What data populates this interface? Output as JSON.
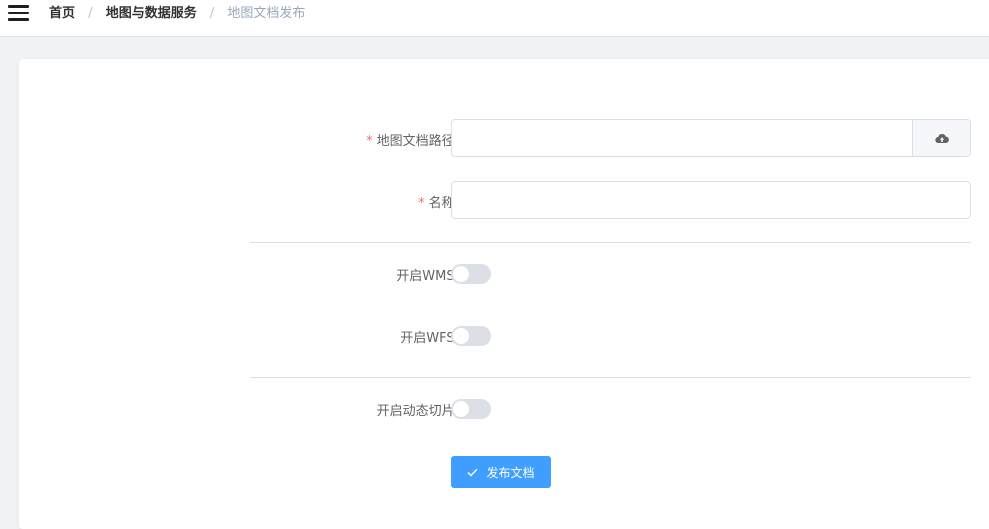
{
  "header": {
    "breadcrumb": {
      "home": "首页",
      "section": "地图与数据服务",
      "current": "地图文档发布",
      "separator": "/"
    }
  },
  "form": {
    "path_field": {
      "required_mark": "*",
      "label": "地图文档路径:",
      "value": "",
      "placeholder": "",
      "upload_icon": "cloud-upload-icon"
    },
    "name_field": {
      "required_mark": "*",
      "label": "名称:",
      "value": "",
      "placeholder": ""
    },
    "wms_switch": {
      "label": "开启WMS:",
      "enabled": false
    },
    "wfs_switch": {
      "label": "开启WFS:",
      "enabled": false
    },
    "tile_switch": {
      "label": "开启动态切片:",
      "enabled": false
    },
    "submit": {
      "label": "发布文档",
      "icon": "check-icon"
    }
  },
  "colors": {
    "primary": "#409eff",
    "required": "#f56c6c",
    "switch_off": "#dcdfe6",
    "breadcrumb_current": "#97a8be"
  }
}
